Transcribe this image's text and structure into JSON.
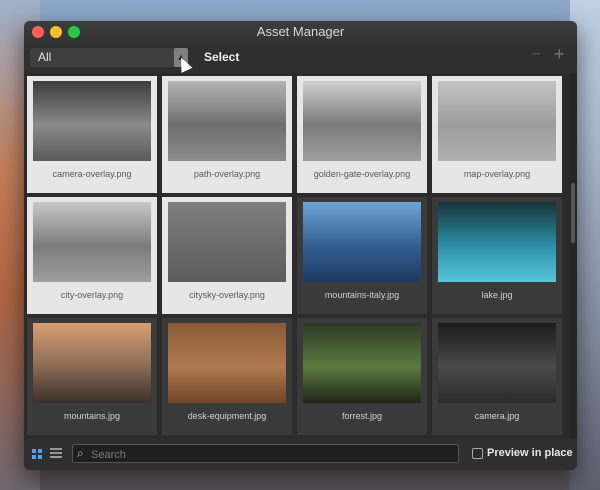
{
  "window": {
    "title": "Asset Manager"
  },
  "toolbar": {
    "filter_value": "All",
    "select_label": "Select",
    "minus_label": "−",
    "plus_label": "+"
  },
  "assets": [
    {
      "name": "camera-overlay.png",
      "style": "light",
      "colors": [
        "#3c3c3c",
        "#8a8a8a",
        "#5a5a5a"
      ]
    },
    {
      "name": "path-overlay.png",
      "style": "light",
      "colors": [
        "#b5b5b5",
        "#6e6e6e",
        "#8c8c8c"
      ]
    },
    {
      "name": "golden-gate-overlay.png",
      "style": "light",
      "colors": [
        "#d0d0d0",
        "#7a7a7a",
        "#a0a0a0"
      ]
    },
    {
      "name": "map-overlay.png",
      "style": "light",
      "colors": [
        "#c4c4c4",
        "#9d9d9d",
        "#b0b0b0"
      ]
    },
    {
      "name": "city-overlay.png",
      "style": "light",
      "colors": [
        "#c8c8c8",
        "#7c7c7c",
        "#9e9e9e"
      ]
    },
    {
      "name": "citysky-overlay.png",
      "style": "light",
      "colors": [
        "#808080",
        "#6a6a6a",
        "#5c5c5c"
      ]
    },
    {
      "name": "mountains-italy.jpg",
      "style": "dark",
      "colors": [
        "#6fa3d6",
        "#335f92",
        "#1e3a62"
      ]
    },
    {
      "name": "lake.jpg",
      "style": "dark",
      "colors": [
        "#16353a",
        "#2d8fa6",
        "#57c7d8"
      ]
    },
    {
      "name": "mountains.jpg",
      "style": "dark",
      "colors": [
        "#d9a071",
        "#8a6a55",
        "#3b3029"
      ]
    },
    {
      "name": "desk-equipment.jpg",
      "style": "dark",
      "colors": [
        "#8a5a38",
        "#b07a50",
        "#6e4528"
      ]
    },
    {
      "name": "forrest.jpg",
      "style": "dark",
      "colors": [
        "#2c3a26",
        "#5a7a3e",
        "#1d2618"
      ]
    },
    {
      "name": "camera.jpg",
      "style": "dark",
      "colors": [
        "#1c1c1c",
        "#4a4a4a",
        "#2a2a2a"
      ]
    }
  ],
  "bottom": {
    "search_placeholder": "Search",
    "preview_label": "Preview in place"
  }
}
